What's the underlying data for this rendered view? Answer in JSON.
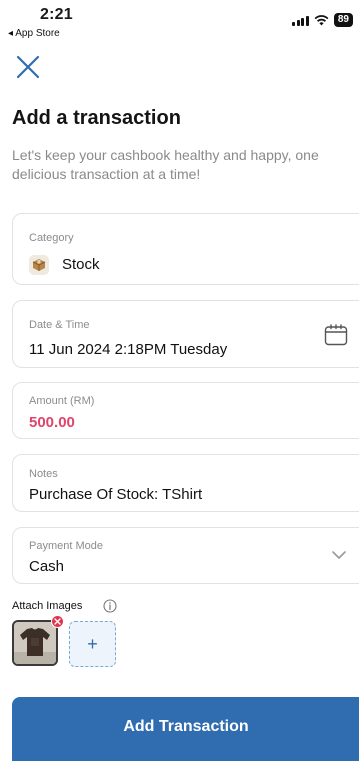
{
  "status_bar": {
    "time": "2:21",
    "back_app": "◂ App Store",
    "battery": "89"
  },
  "header": {
    "close_icon": "close-icon"
  },
  "page": {
    "title": "Add a transaction",
    "subtitle": "Let's keep your cashbook healthy and happy, one\ndelicious transaction at a time!"
  },
  "form": {
    "category": {
      "label": "Category",
      "value": "Stock",
      "icon": "box-icon"
    },
    "datetime": {
      "label": "Date & Time",
      "value": "11 Jun 2024 2:18PM Tuesday",
      "icon": "calendar-icon"
    },
    "amount": {
      "label": "Amount (RM)",
      "value": "500.00",
      "color": "#e0446a"
    },
    "notes": {
      "label": "Notes",
      "value": "Purchase Of Stock: TShirt"
    },
    "payment_mode": {
      "label": "Payment Mode",
      "value": "Cash"
    }
  },
  "attachments": {
    "label": "Attach Images",
    "images": [
      {
        "name": "tshirt-photo"
      }
    ],
    "add_symbol": "+"
  },
  "actions": {
    "submit_label": "Add Transaction",
    "accent": "#2f6db0"
  }
}
